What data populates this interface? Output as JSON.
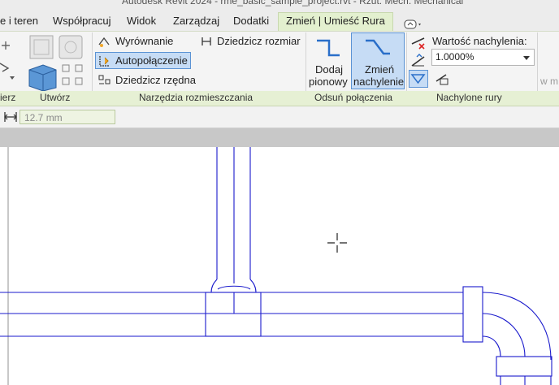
{
  "window": {
    "title": "Autodesk Revit 2024 - rme_basic_sample_project.rvt - Rzut: Mech. Mechanical"
  },
  "tabs": [
    {
      "label": "e i teren",
      "active": false
    },
    {
      "label": "Współpracuj",
      "active": false
    },
    {
      "label": "Widok",
      "active": false
    },
    {
      "label": "Zarządzaj",
      "active": false
    },
    {
      "label": "Dodatki",
      "active": false
    },
    {
      "label": "Zmień | Umieść Rura",
      "active": true
    }
  ],
  "ribbon": {
    "panels": [
      {
        "label": "ierz"
      },
      {
        "label": "Utwórz"
      },
      {
        "label": "Narzędzia rozmieszczania"
      },
      {
        "label": "Odsuń połączenia"
      },
      {
        "label": "Nachylone rury"
      }
    ],
    "placement_tools": {
      "align": "Wyrównanie",
      "autoconnect": "Autopołączenie",
      "inherit_elevation": "Dziedzicz rzędna",
      "inherit_size": "Dziedzicz rozmiar"
    },
    "offset_connections": {
      "add_vertical_line1": "Dodaj",
      "add_vertical_line2": "pionowy",
      "change_slope_line1": "Zmień",
      "change_slope_line2": "nachylenie"
    },
    "sloped_pipes": {
      "slope_value_label": "Wartość nachylenia:",
      "slope_value": "1.0000%"
    },
    "overflow_text": "w m"
  },
  "options_bar": {
    "size_field": "12.7 mm"
  },
  "colors": {
    "accent_active": "#c6dcf5",
    "pipe_lines": "#1a1acc",
    "context_tab": "#e3f0cf"
  }
}
